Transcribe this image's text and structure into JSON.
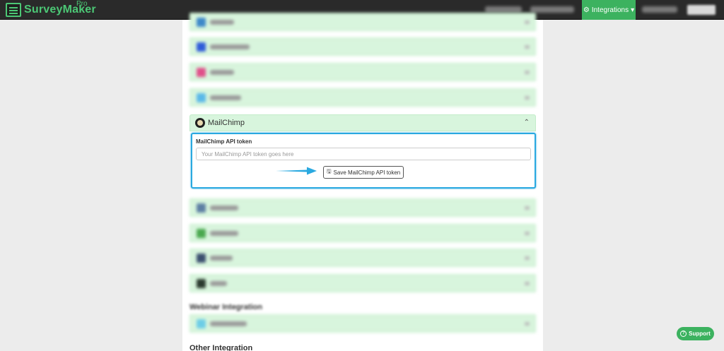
{
  "navbar": {
    "logo_text": "SurveyMaker",
    "logo_suffix": "Pro",
    "active_item": "Integrations",
    "caret": "▾",
    "integrations_icon": "gears-icon"
  },
  "mailchimp": {
    "title": "MailChimp",
    "chevron": "⌃",
    "label": "MailChimp API token",
    "placeholder": "Your MailChimp API token goes here",
    "save_label": "Save MailChimp API token",
    "save_icon": "🖫"
  },
  "sections": {
    "other_title": "Other Integration",
    "webinar_title": "Webinar Integration"
  },
  "support": {
    "label": "Support",
    "icon": "?"
  },
  "colors": {
    "accent_green": "#3cb25f",
    "highlight_blue": "#2aa9e0",
    "row_bg": "#d8f5dd"
  }
}
